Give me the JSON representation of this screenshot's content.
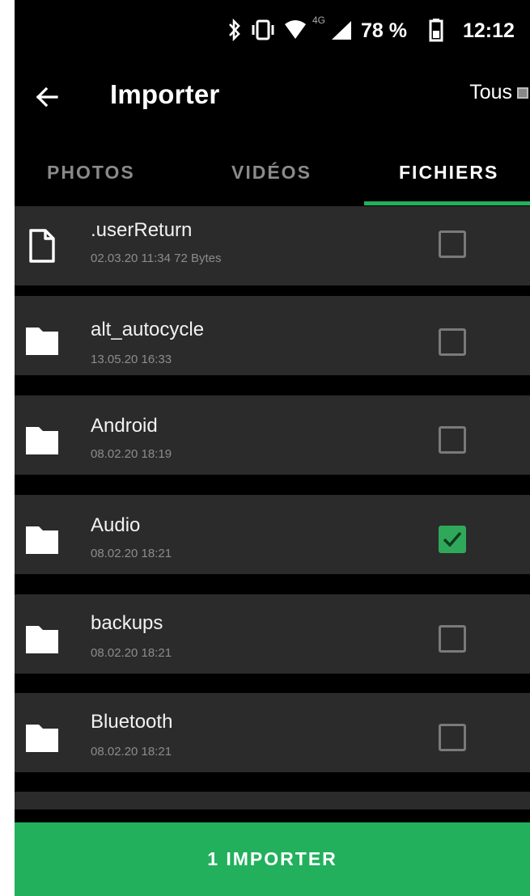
{
  "status_bar": {
    "bluetooth_icon": "bluetooth-icon",
    "vibrate_icon": "vibrate-icon",
    "wifi_icon": "wifi-icon",
    "network_label": "4G",
    "signal_icon": "signal-icon",
    "battery_percent": "78 %",
    "battery_icon": "battery-icon",
    "time": "12:12"
  },
  "app_bar": {
    "back_icon": "arrow-left-icon",
    "title": "Importer",
    "filter_label": "Tous"
  },
  "tabs": [
    {
      "label": "PHOTOS",
      "active": false
    },
    {
      "label": "VIDÉOS",
      "active": false
    },
    {
      "label": "FICHIERS",
      "active": true
    }
  ],
  "files": [
    {
      "name": ".userReturn",
      "meta": "02.03.20 11:34 72 Bytes",
      "type": "file",
      "checked": false
    },
    {
      "name": "alt_autocycle",
      "meta": "13.05.20 16:33",
      "type": "folder",
      "checked": false
    },
    {
      "name": "Android",
      "meta": "08.02.20 18:19",
      "type": "folder",
      "checked": false
    },
    {
      "name": "Audio",
      "meta": "08.02.20 18:21",
      "type": "folder",
      "checked": true
    },
    {
      "name": "backups",
      "meta": "08.02.20 18:21",
      "type": "folder",
      "checked": false
    },
    {
      "name": "Bluetooth",
      "meta": "08.02.20 18:21",
      "type": "folder",
      "checked": false
    }
  ],
  "import_button": {
    "label": "1 IMPORTER"
  },
  "colors": {
    "accent": "#22b05c",
    "row_background": "#2b2b2b",
    "background": "#000000"
  }
}
